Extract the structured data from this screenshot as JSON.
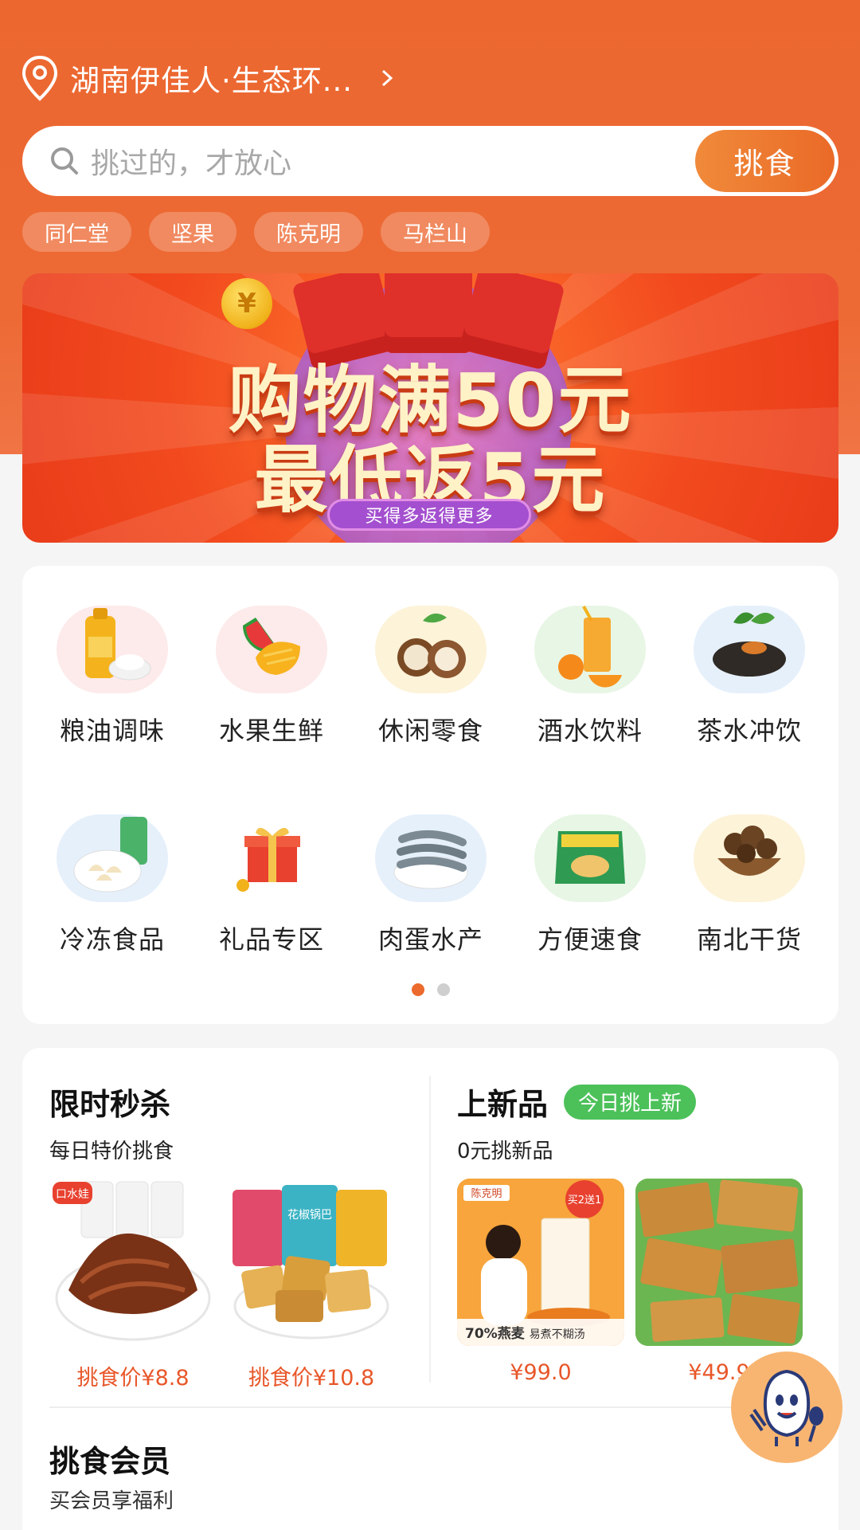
{
  "header": {
    "location": "湖南伊佳人·生态环...",
    "search_placeholder": "挑过的，才放心",
    "search_button": "挑食",
    "chips": [
      "同仁堂",
      "坚果",
      "陈克明",
      "马栏山"
    ]
  },
  "banner": {
    "line1": "购物满50元",
    "line2": "最低返5元",
    "tagline": "买得多返得更多",
    "coin_symbol": "¥"
  },
  "categories": {
    "row1": [
      {
        "label": "粮油调味",
        "icon": "cooking-oil-icon",
        "bg": "#fdeaea"
      },
      {
        "label": "水果生鲜",
        "icon": "fruit-icon",
        "bg": "#fdeaea"
      },
      {
        "label": "休闲零食",
        "icon": "snack-nut-icon",
        "bg": "#fdf3d9"
      },
      {
        "label": "酒水饮料",
        "icon": "drink-icon",
        "bg": "#e8f6e5"
      },
      {
        "label": "茶水冲饮",
        "icon": "tea-icon",
        "bg": "#e6f0fb"
      }
    ],
    "row2": [
      {
        "label": "冷冻食品",
        "icon": "dumpling-icon",
        "bg": "#e6f0fb"
      },
      {
        "label": "礼品专区",
        "icon": "gift-icon",
        "bg": "#ffffff"
      },
      {
        "label": "肉蛋水产",
        "icon": "shrimp-icon",
        "bg": "#e6f0fb"
      },
      {
        "label": "方便速食",
        "icon": "instant-noodle-icon",
        "bg": "#e8f6e5"
      },
      {
        "label": "南北干货",
        "icon": "mushroom-icon",
        "bg": "#fdf3d9"
      }
    ],
    "page_count": 2,
    "active_page": 1
  },
  "flash_sale": {
    "title": "限时秒杀",
    "subtitle": "每日特价挑食",
    "products": [
      {
        "price": "挑食价¥8.8",
        "brand_tag": "口水娃"
      },
      {
        "price": "挑食价¥10.8",
        "pack_label": "花椒锅巴"
      }
    ]
  },
  "new_arrivals": {
    "title": "上新品",
    "badge": "今日挑上新",
    "subtitle": "0元挑新品",
    "products": [
      {
        "price": "¥99.0",
        "brand": "陈克明",
        "promo": "买2送1",
        "caption": "70%燕麦",
        "caption2": "易煮不糊汤"
      },
      {
        "price": "¥49.9"
      }
    ]
  },
  "member": {
    "title": "挑食会员",
    "subtitle": "买会员享福利"
  },
  "colors": {
    "brand_orange": "#ec6730",
    "price_red": "#e8572a",
    "badge_green": "#4cc15a",
    "dot_active": "#ec6a2d"
  }
}
